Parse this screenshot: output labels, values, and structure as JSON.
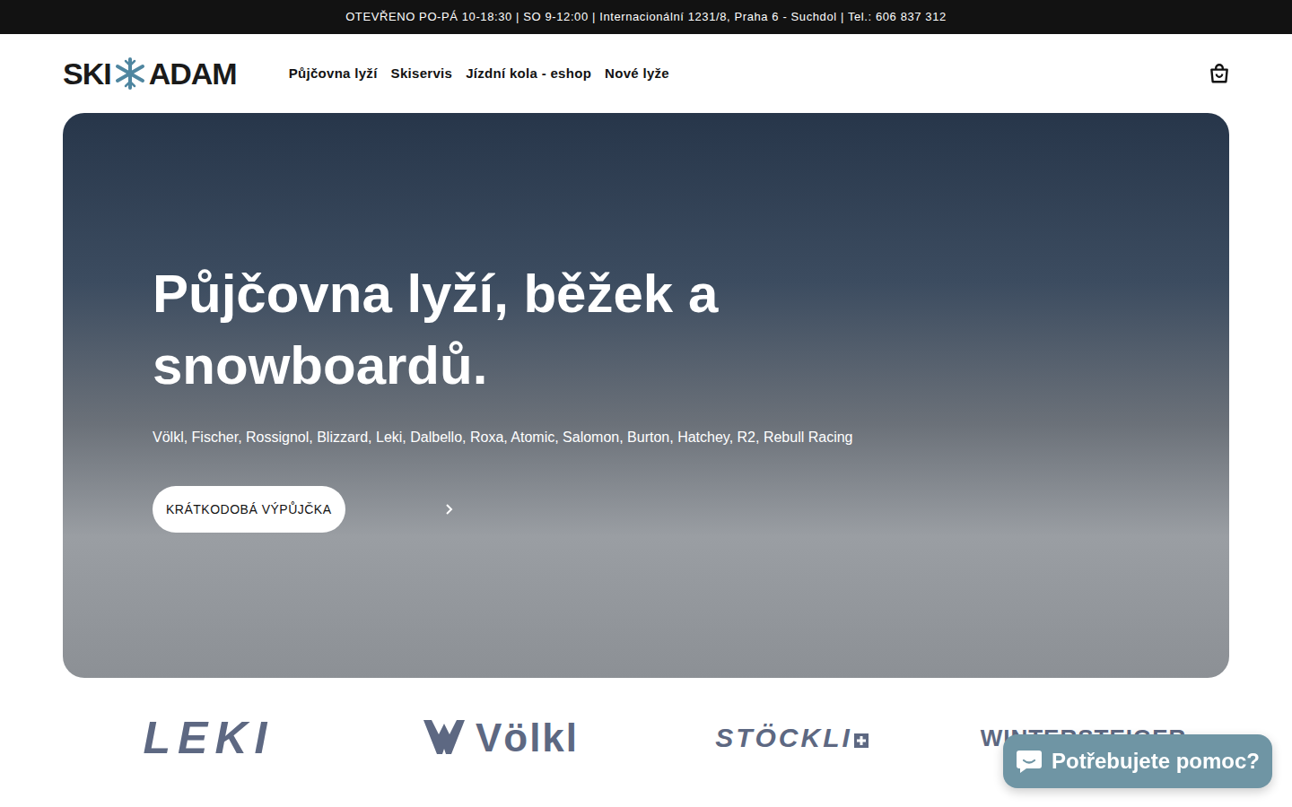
{
  "announcement": "OTEVŘENO PO-PÁ 10-18:30 | SO 9-12:00 | Internacionální 1231/8, Praha 6 - Suchdol | Tel.: 606 837 312",
  "logo": {
    "left": "SKI",
    "right": "ADAM"
  },
  "nav": [
    {
      "label": "Půjčovna lyží"
    },
    {
      "label": "Skiservis"
    },
    {
      "label": "Jízdní kola - eshop"
    },
    {
      "label": "Nové lyže"
    }
  ],
  "hero": {
    "title": "Půjčovna lyží, běžek a snowboardů.",
    "subtitle": "Völkl, Fischer, Rossignol, Blizzard, Leki, Dalbello, Roxa, Atomic, Salomon, Burton, Hatchey, R2, Rebull Racing",
    "button": "KRÁTKODOBÁ VÝPŮJČKA"
  },
  "brands": [
    {
      "label": "LEKI",
      "kind": "leki"
    },
    {
      "label": "Völkl",
      "kind": "volkl"
    },
    {
      "label": "STÖCKLI",
      "kind": "stockli"
    },
    {
      "label": "WINTERSTEIGER",
      "kind": "wintersteiger"
    }
  ],
  "chat": {
    "label": "Potřebujete pomoc?"
  }
}
